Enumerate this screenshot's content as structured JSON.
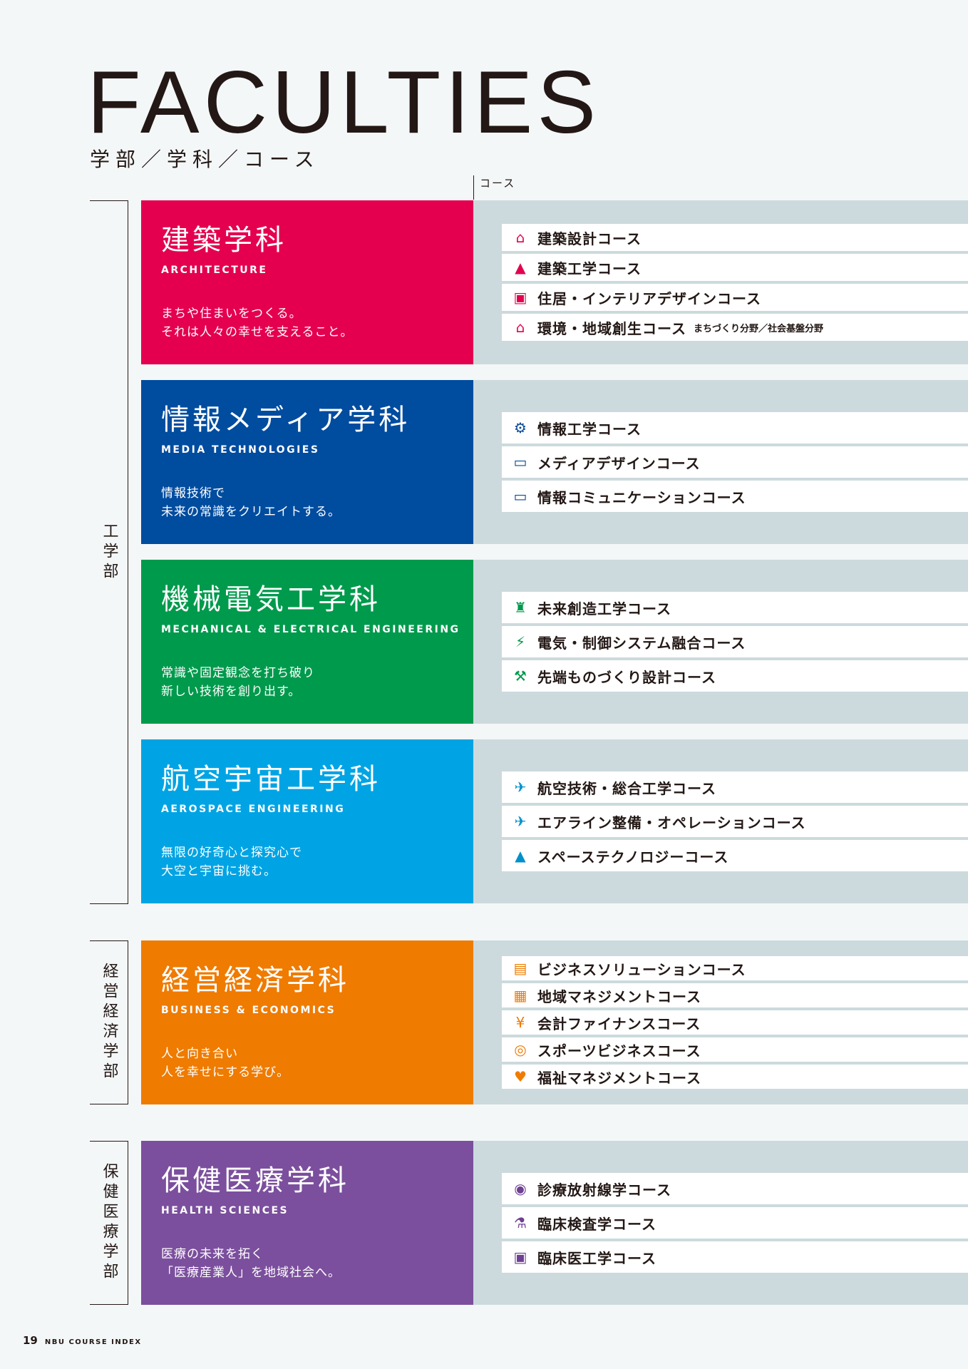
{
  "header": {
    "title": "FACULTIES",
    "subtitle": "学部／学科／コース",
    "course_label": "コース"
  },
  "faculties": [
    {
      "label": "工学部"
    },
    {
      "label": "経営経済学部"
    },
    {
      "label": "保健医療学部"
    }
  ],
  "departments": [
    {
      "name": "建築学科",
      "en": "ARCHITECTURE",
      "desc1": "まちや住まいをつくる。",
      "desc2": "それは人々の幸せを支えること。",
      "color": "#e4004f",
      "icon_color": "#e4004f",
      "courses": [
        {
          "label": "建築設計コース",
          "icon": "building-icon"
        },
        {
          "label": "建築工学コース",
          "icon": "crane-icon"
        },
        {
          "label": "住居・インテリアデザインコース",
          "icon": "interior-icon"
        },
        {
          "label": "環境・地域創生コース",
          "icon": "town-icon",
          "note": "まちづくり分野／社会基盤分野"
        }
      ]
    },
    {
      "name": "情報メディア学科",
      "en": "MEDIA TECHNOLOGIES",
      "desc1": "情報技術で",
      "desc2": "未来の常識をクリエイトする。",
      "color": "#004c9f",
      "icon_color": "#0a4a96",
      "courses": [
        {
          "label": "情報工学コース",
          "icon": "computer-gear-icon"
        },
        {
          "label": "メディアデザインコース",
          "icon": "design-monitor-icon"
        },
        {
          "label": "情報コミュニケーションコース",
          "icon": "communication-monitor-icon"
        }
      ]
    },
    {
      "name": "機械電気工学科",
      "en": "MECHANICAL & ELECTRICAL ENGINEERING",
      "desc1": "常識や固定観念を打ち破り",
      "desc2": "新しい技術を創り出す。",
      "color": "#009a4c",
      "icon_color": "#009a4c",
      "courses": [
        {
          "label": "未来創造工学コース",
          "icon": "robot-icon"
        },
        {
          "label": "電気・制御システム融合コース",
          "icon": "circuit-icon"
        },
        {
          "label": "先端ものづくり設計コース",
          "icon": "tools-icon"
        }
      ]
    },
    {
      "name": "航空宇宙工学科",
      "en": "AEROSPACE ENGINEERING",
      "desc1": "無限の好奇心と探究心で",
      "desc2": "大空と宇宙に挑む。",
      "color": "#00a4e4",
      "icon_color": "#0090cc",
      "courses": [
        {
          "label": "航空技術・総合工学コース",
          "icon": "airplane-icon"
        },
        {
          "label": "エアライン整備・オペレーションコース",
          "icon": "maintenance-icon"
        },
        {
          "label": "スペーステクノロジーコース",
          "icon": "rocket-icon"
        }
      ]
    },
    {
      "name": "経営経済学科",
      "en": "BUSINESS & ECONOMICS",
      "desc1": "人と向き合い",
      "desc2": "人を幸せにする学び。",
      "color": "#ef7b00",
      "icon_color": "#ef7b00",
      "courses": [
        {
          "label": "ビジネスソリューションコース",
          "icon": "business-icon"
        },
        {
          "label": "地域マネジメントコース",
          "icon": "region-icon"
        },
        {
          "label": "会計ファイナンスコース",
          "icon": "finance-icon"
        },
        {
          "label": "スポーツビジネスコース",
          "icon": "sports-icon"
        },
        {
          "label": "福祉マネジメントコース",
          "icon": "welfare-icon"
        }
      ]
    },
    {
      "name": "保健医療学科",
      "en": "HEALTH SCIENCES",
      "desc1": "医療の未来を拓く",
      "desc2": "「医療産業人」を地域社会へ。",
      "color": "#7b4f9d",
      "icon_color": "#6e3f93",
      "courses": [
        {
          "label": "診療放射線学コース",
          "icon": "radiology-icon"
        },
        {
          "label": "臨床検査学コース",
          "icon": "microscope-icon"
        },
        {
          "label": "臨床医工学コース",
          "icon": "medical-device-icon"
        }
      ]
    }
  ],
  "footer": {
    "page": "19",
    "label": "NBU COURSE INDEX"
  }
}
